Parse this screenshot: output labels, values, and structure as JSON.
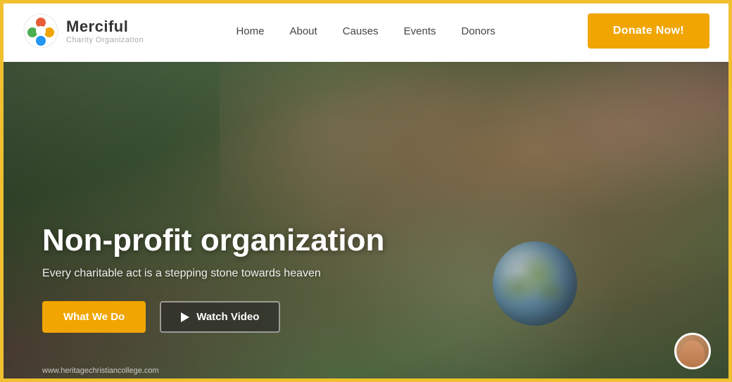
{
  "header": {
    "logo": {
      "title": "Merciful",
      "subtitle": "Charity Organization"
    },
    "nav": {
      "items": [
        {
          "label": "Home",
          "id": "home"
        },
        {
          "label": "About",
          "id": "about"
        },
        {
          "label": "Causes",
          "id": "causes"
        },
        {
          "label": "Events",
          "id": "events"
        },
        {
          "label": "Donors",
          "id": "donors"
        }
      ]
    },
    "donate_button": "Donate Now!"
  },
  "hero": {
    "title": "Non-profit organization",
    "subtitle": "Every charitable act is a stepping stone towards heaven",
    "btn_what_we_do": "What We Do",
    "btn_watch_video": "Watch Video",
    "footer_url": "www.heritagechristiancollege.com"
  }
}
